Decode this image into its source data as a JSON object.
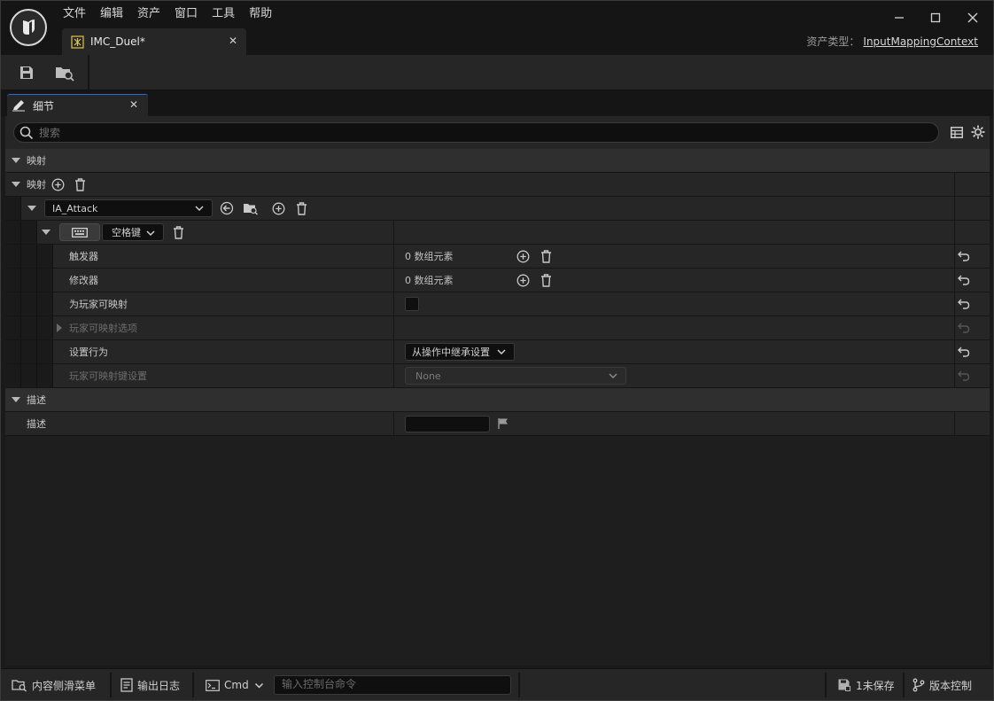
{
  "menu": [
    "文件",
    "编辑",
    "资产",
    "窗口",
    "工具",
    "帮助"
  ],
  "document_tab": {
    "label": "IMC_Duel*"
  },
  "asset_type": {
    "label": "资产类型：",
    "value": "InputMappingContext"
  },
  "details_tab": {
    "label": "细节"
  },
  "search": {
    "placeholder": "搜索"
  },
  "sections": {
    "mappings_category": "映射",
    "mappings_array": "映射",
    "action_combo": "IA_Attack",
    "key_combo": "空格键",
    "triggers": {
      "label": "触发器",
      "value": "0 数组元素"
    },
    "modifiers": {
      "label": "修改器",
      "value": "0 数组元素"
    },
    "player_mappable": {
      "label": "为玩家可映射"
    },
    "player_mappable_options": {
      "label": "玩家可映射选项"
    },
    "setting_behavior": {
      "label": "设置行为",
      "value": "从操作中继承设置"
    },
    "player_mappable_key_settings": {
      "label": "玩家可映射键设置",
      "value": "None"
    },
    "description_category": "描述",
    "description": {
      "label": "描述"
    }
  },
  "statusbar": {
    "content_drawer": "内容侧滑菜单",
    "output_log": "输出日志",
    "cmd": "Cmd",
    "console_placeholder": "输入控制台命令",
    "unsaved": "1未保存",
    "source_control": "版本控制"
  }
}
